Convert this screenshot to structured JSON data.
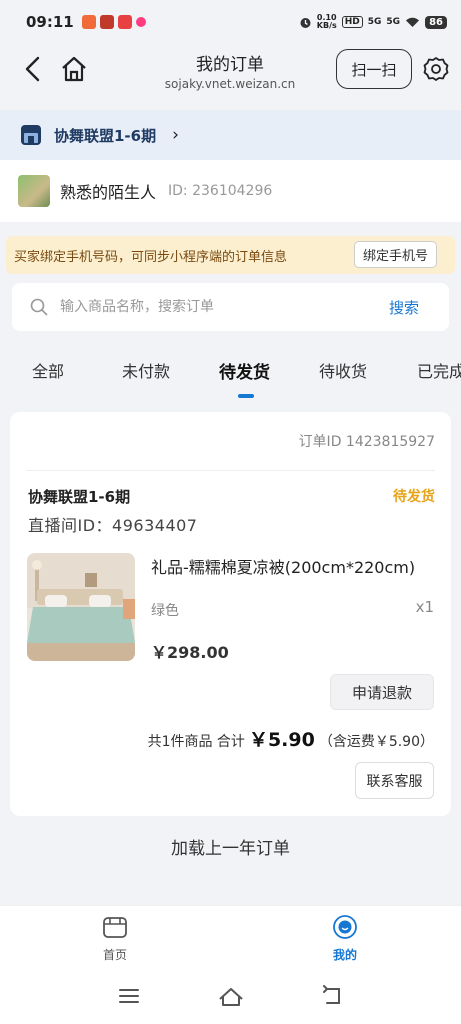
{
  "status_bar": {
    "time": "09:11",
    "net_speed_value": "0.10",
    "net_speed_unit": "KB/s",
    "hd": "HD",
    "signal1": "5G",
    "signal2": "5G",
    "battery": "86"
  },
  "header": {
    "title": "我的订单",
    "url": "sojaky.vnet.weizan.cn",
    "scan_label": "扫一扫"
  },
  "shop_bar": {
    "name": "协舞联盟1-6期",
    "chevron": "›"
  },
  "user": {
    "name": "熟悉的陌生人",
    "id": "ID: 236104296"
  },
  "notice": {
    "text": "买家绑定手机号码，可同步小程序端的订单信息",
    "button": "绑定手机号"
  },
  "search": {
    "placeholder": "输入商品名称，搜索订单",
    "button": "搜索"
  },
  "tabs": [
    {
      "label": "全部"
    },
    {
      "label": "未付款"
    },
    {
      "label": "待发货",
      "active": true
    },
    {
      "label": "待收货"
    },
    {
      "label": "已完成"
    }
  ],
  "order": {
    "order_id": "订单ID 1423815927",
    "shop": "协舞联盟1-6期",
    "status": "待发货",
    "live_id": "直播间ID：49634407",
    "product_name": "礼品-糯糯棉夏凉被(200cm*220cm)",
    "variant": "绿色",
    "qty": "x1",
    "price": "￥298.00",
    "refund_button": "申请退款",
    "total_prefix": "共1件商品 合计",
    "total_amount": "￥5.90",
    "shipping": "（含运费￥5.90）",
    "service_button": "联系客服"
  },
  "load_more": "加载上一年订单",
  "tabbar": {
    "home": "首页",
    "mine": "我的"
  },
  "colors": {
    "accent": "#1677d2",
    "status": "#e8a317",
    "notice_bg": "#fbefcf",
    "shop_bar_bg": "#e8eef8"
  }
}
